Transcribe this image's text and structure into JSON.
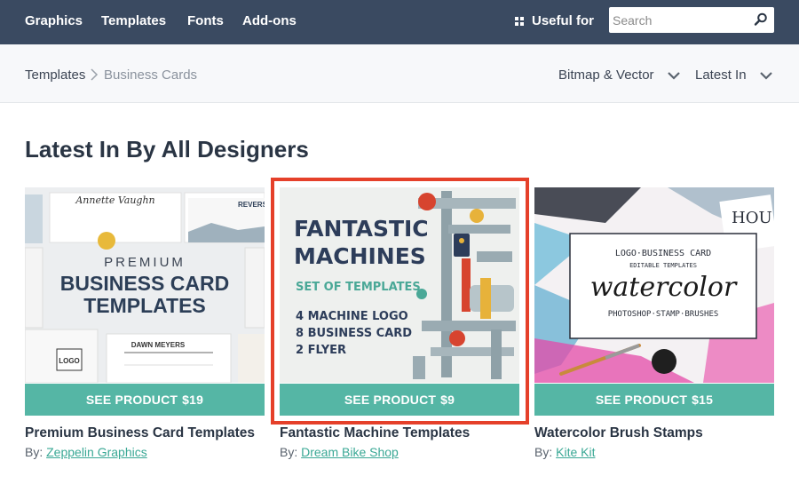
{
  "nav": {
    "items": [
      "Graphics",
      "Templates",
      "Fonts",
      "Add-ons"
    ],
    "useful_for": "Useful for",
    "search_placeholder": "Search"
  },
  "breadcrumb": {
    "home": "Templates",
    "current": "Business Cards"
  },
  "filters": {
    "type": "Bitmap & Vector",
    "sort": "Latest In"
  },
  "page_title": "Latest In By All Designers",
  "button_label": "SEE PRODUCT",
  "by_label": "By:",
  "products": [
    {
      "title": "Premium Business Card Templates",
      "price": "$19",
      "author": "Zeppelin Graphics",
      "image_text": [
        "PREMIUM",
        "BUSINESS CARD",
        "TEMPLATES"
      ],
      "card_texts": [
        "Annette Vaughn",
        "REVERS",
        "DAWN MEYERS",
        "LOGO"
      ]
    },
    {
      "title": "Fantastic Machine Templates",
      "price": "$9",
      "author": "Dream Bike Shop",
      "image_text": [
        "FANTASTIC",
        "MACHINES",
        "SET OF TEMPLATES",
        "4 MACHINE LOGO",
        "8 BUSINESS CARD",
        "2 FLYER"
      ]
    },
    {
      "title": "Watercolor Brush Stamps",
      "price": "$15",
      "author": "Kite Kit",
      "image_text": [
        "LOGO·BUSINESS CARD",
        "EDITABLE TEMPLATES",
        "watercolor",
        "PHOTOSHOP·STAMP·BRUSHES",
        "HOU"
      ]
    }
  ],
  "colors": {
    "nav_bg": "#3a4a61",
    "button_bg": "#55b6a5",
    "link": "#3aa895",
    "highlight": "#e5402a"
  }
}
